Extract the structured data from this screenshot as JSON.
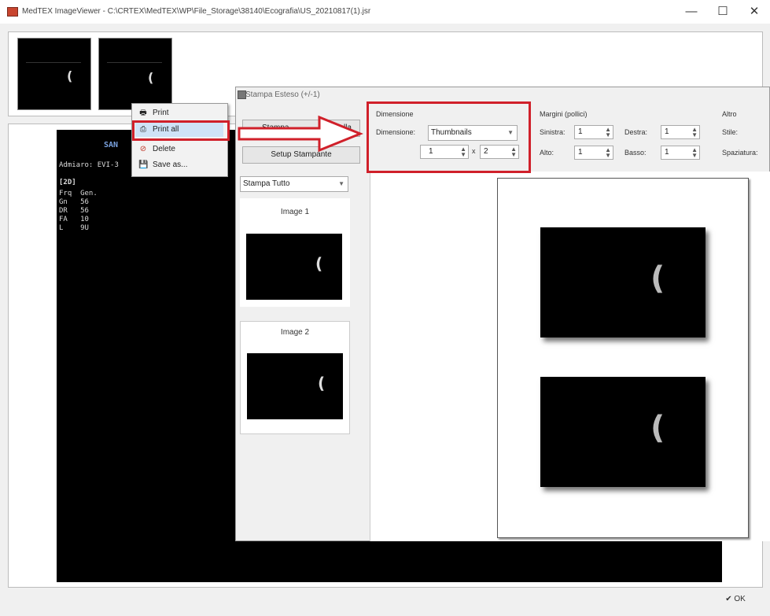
{
  "window": {
    "title": "MedTEX ImageViewer - C:\\CRTEX\\MedTEX\\WP\\File_Storage\\38140\\Ecografia\\US_20210817(1).jsr",
    "minimize_glyph": "—",
    "maximize_glyph": "☐",
    "close_glyph": "✕"
  },
  "context_menu": {
    "items": [
      {
        "label": "Print",
        "icon": "printer-icon",
        "glyph": "🖶"
      },
      {
        "label": "Print all",
        "icon": "print-all-icon",
        "glyph": "⎙",
        "highlighted": true
      },
      {
        "label": "Delete",
        "icon": "delete-icon",
        "glyph": "⊘"
      },
      {
        "label": "Save as...",
        "icon": "save-icon",
        "glyph": "💾"
      }
    ]
  },
  "overlay": {
    "header": "SAN",
    "line1": "Admiaro: EVI-3",
    "line2": "[2D]",
    "params": "Frq  Gen.\nGn   56\nDR   56\nFA   10\nL    9U"
  },
  "dialog": {
    "title": "Stampa Esteso (+/-1)",
    "btn_top_left": "Stampa",
    "btn_top_right": "ella",
    "setup_button": "Setup Stampante",
    "print_mode": "Stampa Tutto",
    "images": [
      {
        "label": "Image 1"
      },
      {
        "label": "Image 2"
      }
    ],
    "dimensions": {
      "group_label": "Dimensione",
      "field_label": "Dimensione:",
      "value": "Thumbnails",
      "cols": "1",
      "times": "x",
      "rows": "2"
    },
    "margins": {
      "group_label": "Margini (pollici)",
      "left_label": "Sinistra:",
      "left_value": "1",
      "right_label": "Destra:",
      "right_value": "1",
      "top_label": "Alto:",
      "top_value": "1",
      "bottom_label": "Basso:",
      "bottom_value": "1"
    },
    "other": {
      "group_label": "Altro",
      "field1_label": "Stile:",
      "field2_label": "Spaziatura:"
    }
  },
  "ok_button": "✔ OK",
  "colors": {
    "annotation_red": "#d0202a",
    "background": "#f0f0f0"
  }
}
